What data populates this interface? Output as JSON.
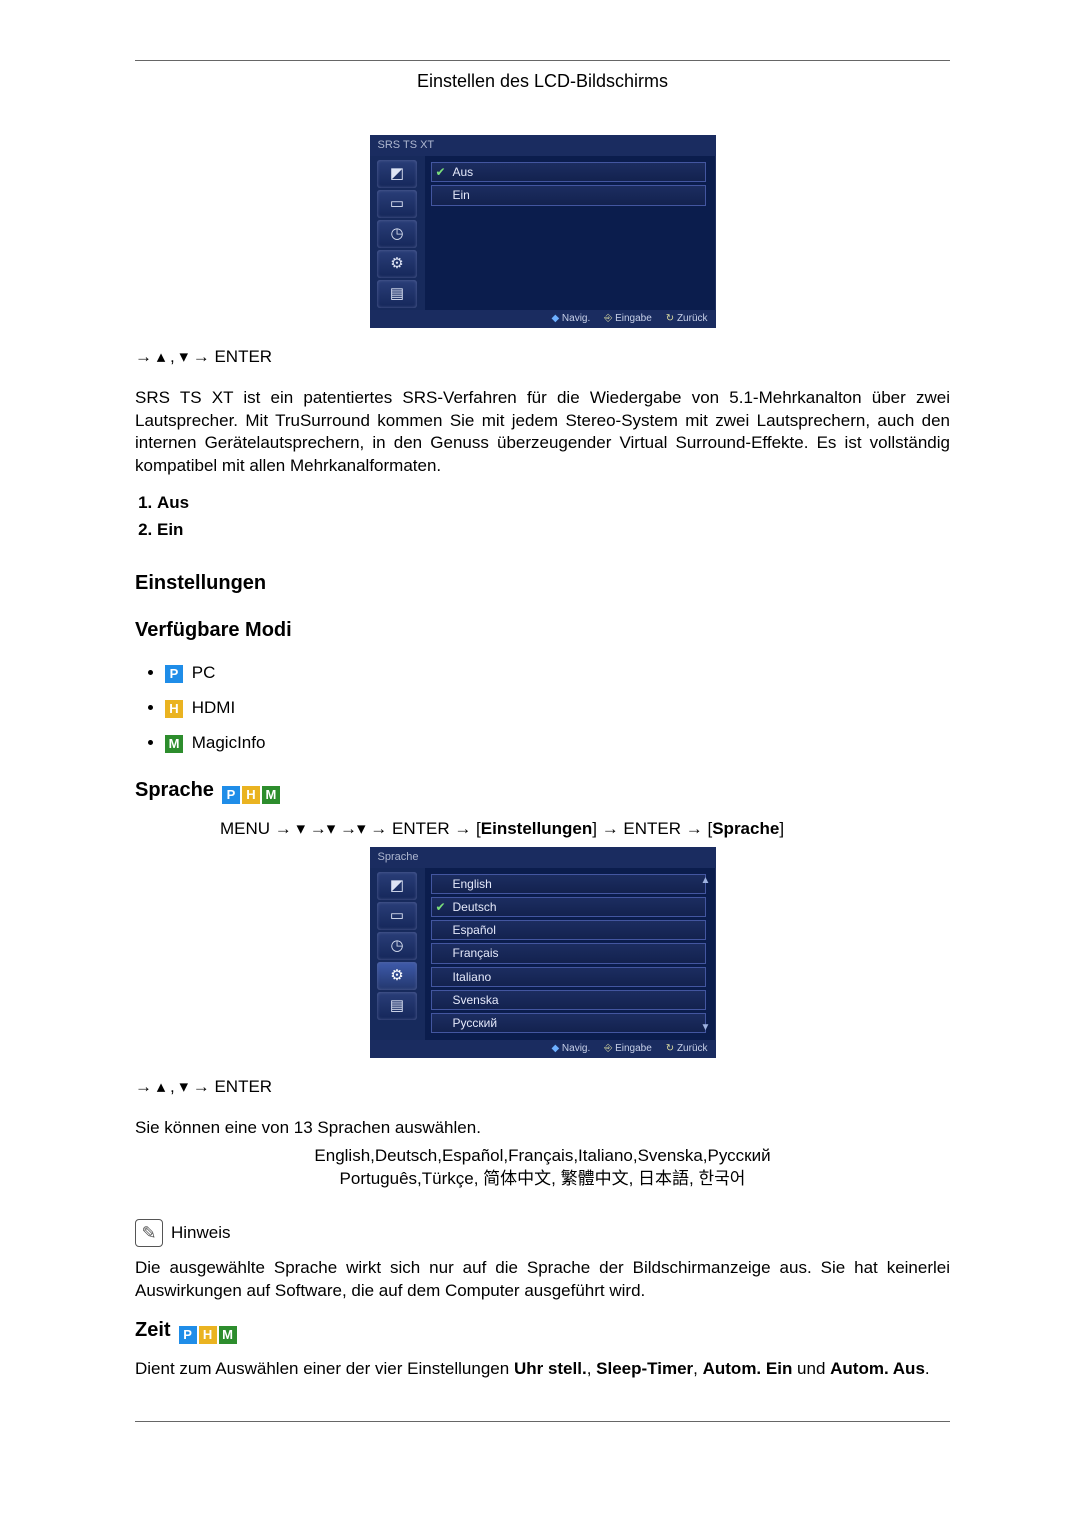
{
  "header": {
    "title": "Einstellen des LCD-Bildschirms"
  },
  "srs": {
    "osd": {
      "title": "SRS TS XT",
      "options": [
        {
          "label": "Aus",
          "selected": true
        },
        {
          "label": "Ein",
          "selected": false
        }
      ],
      "side_icons": [
        "picture-icon",
        "sound-icon",
        "clock-icon",
        "gear-icon",
        "card-icon"
      ],
      "foot": {
        "navig": "Navig.",
        "eingabe": "Eingabe",
        "zurueck": "Zurück"
      }
    },
    "nav": {
      "arrow_r": "→",
      "tri_up": "▴",
      "sep": " , ",
      "tri_down": "▾",
      "arrow_r2": " → ",
      "enter": "ENTER"
    },
    "description": "SRS TS XT ist ein patentiertes SRS-Verfahren für die Wiedergabe von 5.1-Mehrkanalton über zwei Lautsprecher. Mit TruSurround kommen Sie mit jedem Stereo-System mit zwei Lautsprechern, auch den internen Gerätelautsprechern, in den Genuss überzeugender Virtual Surround-Effekte. Es ist vollständig kompatibel mit allen Mehrkanalformaten.",
    "list": [
      "Aus",
      "Ein"
    ]
  },
  "settings": {
    "heading": "Einstellungen",
    "modes_heading": "Verfügbare Modi",
    "modes": [
      {
        "chip": "P",
        "name": "PC"
      },
      {
        "chip": "H",
        "name": "HDMI"
      },
      {
        "chip": "M",
        "name": "MagicInfo"
      }
    ]
  },
  "sprache": {
    "heading": "Sprache",
    "chips": [
      "P",
      "H",
      "M"
    ],
    "menu_path": {
      "start": "MENU → ▾ →▾ →▾ → ENTER → [",
      "node1": "Einstellungen",
      "mid": "] → ENTER → [",
      "node2": "Sprache",
      "end": "]"
    },
    "osd": {
      "title": "Sprache",
      "options": [
        {
          "label": "English",
          "selected": false
        },
        {
          "label": "Deutsch",
          "selected": true
        },
        {
          "label": "Español",
          "selected": false
        },
        {
          "label": "Français",
          "selected": false
        },
        {
          "label": "Italiano",
          "selected": false
        },
        {
          "label": "Svenska",
          "selected": false
        },
        {
          "label": "Русский",
          "selected": false
        }
      ],
      "side_icons": [
        "picture-icon",
        "sound-icon",
        "clock-icon",
        "gear-icon",
        "card-icon"
      ],
      "selected_side_index": 3,
      "foot": {
        "navig": "Navig.",
        "eingabe": "Eingabe",
        "zurueck": "Zurück"
      }
    },
    "nav": {
      "arrow_r": "→",
      "tri_up": "▴",
      "sep": " , ",
      "tri_down": "▾",
      "arrow_r2": " → ",
      "enter": "ENTER"
    },
    "select_text": "Sie können eine von 13 Sprachen auswählen.",
    "lang_line1": "English,Deutsch,Español,Français,Italiano,Svenska,Русский",
    "lang_line2": "Português,Türkçe, 简体中文,  繁體中文, 日本語, 한국어",
    "hinweis_label": "Hinweis",
    "hinweis_text": "Die ausgewählte Sprache wirkt sich nur auf die Sprache der Bildschirmanzeige aus. Sie hat keinerlei Auswirkungen auf Software, die auf dem Computer ausgeführt wird."
  },
  "zeit": {
    "heading": "Zeit",
    "chips": [
      "P",
      "H",
      "M"
    ],
    "text_pre": "Dient zum Auswählen einer der vier Einstellungen ",
    "opt1": "Uhr stell.",
    "sep": ", ",
    "opt2": "Sleep-Timer",
    "opt3": "Autom. Ein",
    "and": " und ",
    "opt4": "Autom. Aus",
    "period": "."
  }
}
